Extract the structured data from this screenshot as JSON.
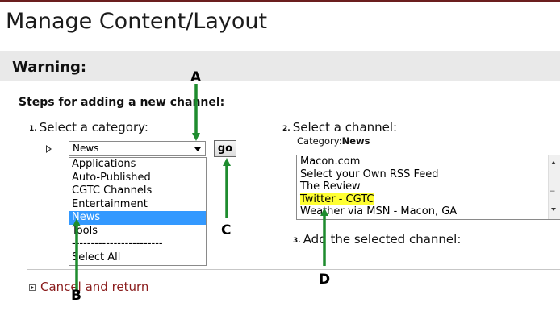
{
  "page": {
    "title": "Manage Content/Layout",
    "warning": "Warning:",
    "steps_heading": "Steps for adding a new channel:"
  },
  "step1": {
    "num": "1.",
    "label": "Select a category:",
    "selected": "News",
    "go_label": "go",
    "options": [
      "Applications",
      "Auto-Published",
      "CGTC Channels",
      "Entertainment",
      "News",
      "Tools",
      "------------------------",
      "Select All"
    ]
  },
  "step2": {
    "num": "2.",
    "label": "Select a channel:",
    "category_prefix": "Category:",
    "category_value": "News",
    "channels": [
      "Macon.com",
      "Select your Own RSS Feed",
      "The Review",
      "Twitter - CGTC",
      "Weather via MSN - Macon, GA"
    ],
    "highlighted": "Twitter - CGTC"
  },
  "step3": {
    "num": "3.",
    "label": "Add the selected channel:"
  },
  "cancel_link": "Cancel and return",
  "annotations": {
    "A": "A",
    "B": "B",
    "C": "C",
    "D": "D",
    "color": "#1e8c2e"
  },
  "colors": {
    "selection": "#3399ff",
    "highlight": "#ffff33",
    "link": "#8a1c1c"
  }
}
